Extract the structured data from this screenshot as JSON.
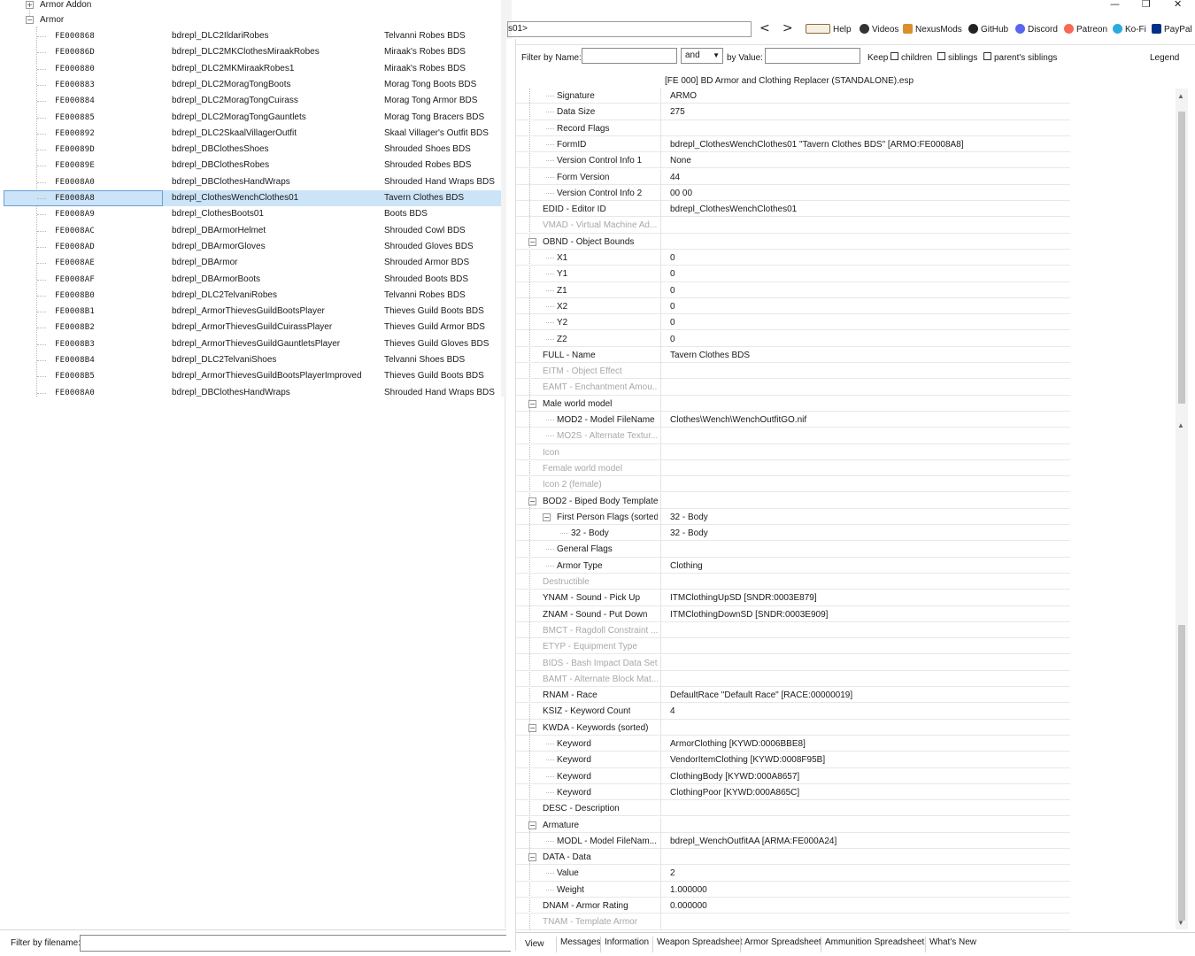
{
  "window": {
    "minimize": "—",
    "restore": "❐",
    "close": "✕"
  },
  "tree": {
    "nodes": [
      {
        "label": "Armor Addon",
        "expander": "+"
      },
      {
        "label": "Armor",
        "expander": "−"
      }
    ],
    "selected_index": 10,
    "records": [
      {
        "formid": "FE000868",
        "editor_id": "bdrepl_DLC2IldariRobes",
        "name": "Telvanni Robes BDS"
      },
      {
        "formid": "FE00086D",
        "editor_id": "bdrepl_DLC2MKClothesMiraakRobes",
        "name": "Miraak's Robes BDS"
      },
      {
        "formid": "FE000880",
        "editor_id": "bdrepl_DLC2MKMiraakRobes1",
        "name": "Miraak's Robes BDS"
      },
      {
        "formid": "FE000883",
        "editor_id": "bdrepl_DLC2MoragTongBoots",
        "name": "Morag Tong Boots BDS"
      },
      {
        "formid": "FE000884",
        "editor_id": "bdrepl_DLC2MoragTongCuirass",
        "name": "Morag Tong Armor BDS"
      },
      {
        "formid": "FE000885",
        "editor_id": "bdrepl_DLC2MoragTongGauntlets",
        "name": "Morag Tong Bracers BDS"
      },
      {
        "formid": "FE000892",
        "editor_id": "bdrepl_DLC2SkaalVillagerOutfit",
        "name": "Skaal Villager's Outfit BDS"
      },
      {
        "formid": "FE00089D",
        "editor_id": "bdrepl_DBClothesShoes",
        "name": "Shrouded Shoes BDS"
      },
      {
        "formid": "FE00089E",
        "editor_id": "bdrepl_DBClothesRobes",
        "name": "Shrouded Robes BDS"
      },
      {
        "formid": "FE0008A0",
        "editor_id": "bdrepl_DBClothesHandWraps",
        "name": "Shrouded Hand Wraps BDS"
      },
      {
        "formid": "FE0008A8",
        "editor_id": "bdrepl_ClothesWenchClothes01",
        "name": "Tavern Clothes BDS"
      },
      {
        "formid": "FE0008A9",
        "editor_id": "bdrepl_ClothesBoots01",
        "name": "Boots BDS"
      },
      {
        "formid": "FE0008AC",
        "editor_id": "bdrepl_DBArmorHelmet",
        "name": "Shrouded Cowl BDS"
      },
      {
        "formid": "FE0008AD",
        "editor_id": "bdrepl_DBArmorGloves",
        "name": "Shrouded Gloves BDS"
      },
      {
        "formid": "FE0008AE",
        "editor_id": "bdrepl_DBArmor",
        "name": "Shrouded Armor BDS"
      },
      {
        "formid": "FE0008AF",
        "editor_id": "bdrepl_DBArmorBoots",
        "name": "Shrouded Boots BDS"
      },
      {
        "formid": "FE0008B0",
        "editor_id": "bdrepl_DLC2TelvaniRobes",
        "name": "Telvanni Robes BDS"
      },
      {
        "formid": "FE0008B1",
        "editor_id": "bdrepl_ArmorThievesGuildBootsPlayer",
        "name": "Thieves Guild Boots BDS"
      },
      {
        "formid": "FE0008B2",
        "editor_id": "bdrepl_ArmorThievesGuildCuirassPlayer",
        "name": "Thieves Guild Armor BDS"
      },
      {
        "formid": "FE0008B3",
        "editor_id": "bdrepl_ArmorThievesGuildGauntletsPlayer",
        "name": "Thieves Guild Gloves BDS"
      },
      {
        "formid": "FE0008B4",
        "editor_id": "bdrepl_DLC2TelvaniShoes",
        "name": "Telvanni Shoes BDS"
      },
      {
        "formid": "FE0008B5",
        "editor_id": "bdrepl_ArmorThievesGuildBootsPlayerImproved",
        "name": "Thieves Guild Boots BDS"
      },
      {
        "formid": "FE0008A0",
        "editor_id": "bdrepl_DBClothesHandWraps",
        "name": "Shrouded Hand Wraps BDS"
      }
    ]
  },
  "left_filter": {
    "label": "Filter by filename:",
    "value": ""
  },
  "toolbar": {
    "path": "s01>",
    "back": "<",
    "forward": ">",
    "links": [
      {
        "label": "Help",
        "icon": "book-icon",
        "color": "#8a6a3a"
      },
      {
        "label": "Videos",
        "icon": "film-icon",
        "color": "#333333"
      },
      {
        "label": "NexusMods",
        "icon": "nexus-icon",
        "color": "#d98f2b"
      },
      {
        "label": "GitHub",
        "icon": "github-icon",
        "color": "#222222"
      },
      {
        "label": "Discord",
        "icon": "discord-icon",
        "color": "#5865f2"
      },
      {
        "label": "Patreon",
        "icon": "patreon-icon",
        "color": "#f96854"
      },
      {
        "label": "Ko-Fi",
        "icon": "kofi-icon",
        "color": "#29abe0"
      },
      {
        "label": "PayPal",
        "icon": "paypal-icon",
        "color": "#003087"
      }
    ]
  },
  "filter": {
    "by_name_label": "Filter by Name:",
    "name_value": "",
    "operator": "and",
    "by_value_label": "by Value:",
    "value_value": "",
    "keep_label": "Keep",
    "children_label": "children",
    "siblings_label": "siblings",
    "parents_siblings_label": "parent's siblings",
    "legend_label": "Legend"
  },
  "view": {
    "header": "[FE 000] BD Armor and Clothing Replacer (STANDALONE).esp",
    "rows": [
      {
        "key": "Signature",
        "value": "ARMO",
        "level": 1,
        "dim": false,
        "expander": ""
      },
      {
        "key": "Data Size",
        "value": "275",
        "level": 1,
        "dim": false,
        "expander": ""
      },
      {
        "key": "Record Flags",
        "value": "",
        "level": 1,
        "dim": false,
        "expander": ""
      },
      {
        "key": "FormID",
        "value": "bdrepl_ClothesWenchClothes01 \"Tavern Clothes BDS\" [ARMO:FE0008A8]",
        "level": 1,
        "dim": false,
        "expander": ""
      },
      {
        "key": "Version Control Info 1",
        "value": "None",
        "level": 1,
        "dim": false,
        "expander": ""
      },
      {
        "key": "Form Version",
        "value": "44",
        "level": 1,
        "dim": false,
        "expander": ""
      },
      {
        "key": "Version Control Info 2",
        "value": "00 00",
        "level": 1,
        "dim": false,
        "expander": ""
      },
      {
        "key": "EDID - Editor ID",
        "value": "bdrepl_ClothesWenchClothes01",
        "level": 0,
        "dim": false,
        "expander": ""
      },
      {
        "key": "VMAD - Virtual Machine Ad...",
        "value": "",
        "level": 0,
        "dim": true,
        "expander": ""
      },
      {
        "key": "OBND - Object Bounds",
        "value": "",
        "level": 0,
        "dim": false,
        "expander": "−"
      },
      {
        "key": "X1",
        "value": "0",
        "level": 1,
        "dim": false,
        "expander": ""
      },
      {
        "key": "Y1",
        "value": "0",
        "level": 1,
        "dim": false,
        "expander": ""
      },
      {
        "key": "Z1",
        "value": "0",
        "level": 1,
        "dim": false,
        "expander": ""
      },
      {
        "key": "X2",
        "value": "0",
        "level": 1,
        "dim": false,
        "expander": ""
      },
      {
        "key": "Y2",
        "value": "0",
        "level": 1,
        "dim": false,
        "expander": ""
      },
      {
        "key": "Z2",
        "value": "0",
        "level": 1,
        "dim": false,
        "expander": ""
      },
      {
        "key": "FULL - Name",
        "value": "Tavern Clothes BDS",
        "level": 0,
        "dim": false,
        "expander": ""
      },
      {
        "key": "EITM - Object Effect",
        "value": "",
        "level": 0,
        "dim": true,
        "expander": ""
      },
      {
        "key": "EAMT - Enchantment Amou...",
        "value": "",
        "level": 0,
        "dim": true,
        "expander": ""
      },
      {
        "key": "Male world model",
        "value": "",
        "level": 0,
        "dim": false,
        "expander": "−"
      },
      {
        "key": "MOD2 - Model FileName",
        "value": "Clothes\\Wench\\WenchOutfitGO.nif",
        "level": 1,
        "dim": false,
        "expander": ""
      },
      {
        "key": "MO2S - Alternate Textur...",
        "value": "",
        "level": 1,
        "dim": true,
        "expander": ""
      },
      {
        "key": "Icon",
        "value": "",
        "level": 0,
        "dim": true,
        "expander": ""
      },
      {
        "key": "Female world model",
        "value": "",
        "level": 0,
        "dim": true,
        "expander": ""
      },
      {
        "key": "Icon 2 (female)",
        "value": "",
        "level": 0,
        "dim": true,
        "expander": ""
      },
      {
        "key": "BOD2 - Biped Body Template",
        "value": "",
        "level": 0,
        "dim": false,
        "expander": "−"
      },
      {
        "key": "First Person Flags (sorted)",
        "value": "32 - Body",
        "level": 1,
        "dim": false,
        "expander": "−"
      },
      {
        "key": "32 - Body",
        "value": "32 - Body",
        "level": 2,
        "dim": false,
        "expander": ""
      },
      {
        "key": "General Flags",
        "value": "",
        "level": 1,
        "dim": false,
        "expander": ""
      },
      {
        "key": "Armor Type",
        "value": "Clothing",
        "level": 1,
        "dim": false,
        "expander": ""
      },
      {
        "key": "Destructible",
        "value": "",
        "level": 0,
        "dim": true,
        "expander": ""
      },
      {
        "key": "YNAM - Sound - Pick Up",
        "value": "ITMClothingUpSD [SNDR:0003E879]",
        "level": 0,
        "dim": false,
        "expander": ""
      },
      {
        "key": "ZNAM - Sound - Put Down",
        "value": "ITMClothingDownSD [SNDR:0003E909]",
        "level": 0,
        "dim": false,
        "expander": ""
      },
      {
        "key": "BMCT - Ragdoll Constraint ...",
        "value": "",
        "level": 0,
        "dim": true,
        "expander": ""
      },
      {
        "key": "ETYP - Equipment Type",
        "value": "",
        "level": 0,
        "dim": true,
        "expander": ""
      },
      {
        "key": "BIDS - Bash Impact Data Set",
        "value": "",
        "level": 0,
        "dim": true,
        "expander": ""
      },
      {
        "key": "BAMT - Alternate Block Mat...",
        "value": "",
        "level": 0,
        "dim": true,
        "expander": ""
      },
      {
        "key": "RNAM - Race",
        "value": "DefaultRace \"Default Race\" [RACE:00000019]",
        "level": 0,
        "dim": false,
        "expander": ""
      },
      {
        "key": "KSIZ - Keyword Count",
        "value": "4",
        "level": 0,
        "dim": false,
        "expander": ""
      },
      {
        "key": "KWDA - Keywords (sorted)",
        "value": "",
        "level": 0,
        "dim": false,
        "expander": "−"
      },
      {
        "key": "Keyword",
        "value": "ArmorClothing [KYWD:0006BBE8]",
        "level": 1,
        "dim": false,
        "expander": ""
      },
      {
        "key": "Keyword",
        "value": "VendorItemClothing [KYWD:0008F95B]",
        "level": 1,
        "dim": false,
        "expander": ""
      },
      {
        "key": "Keyword",
        "value": "ClothingBody [KYWD:000A8657]",
        "level": 1,
        "dim": false,
        "expander": ""
      },
      {
        "key": "Keyword",
        "value": "ClothingPoor [KYWD:000A865C]",
        "level": 1,
        "dim": false,
        "expander": ""
      },
      {
        "key": "DESC - Description",
        "value": "",
        "level": 0,
        "dim": false,
        "expander": ""
      },
      {
        "key": "Armature",
        "value": "",
        "level": 0,
        "dim": false,
        "expander": "−"
      },
      {
        "key": "MODL - Model FileNam...",
        "value": "bdrepl_WenchOutfitAA [ARMA:FE000A24]",
        "level": 1,
        "dim": false,
        "expander": ""
      },
      {
        "key": "DATA - Data",
        "value": "",
        "level": 0,
        "dim": false,
        "expander": "−"
      },
      {
        "key": "Value",
        "value": "2",
        "level": 1,
        "dim": false,
        "expander": ""
      },
      {
        "key": "Weight",
        "value": "1.000000",
        "level": 1,
        "dim": false,
        "expander": ""
      },
      {
        "key": "DNAM - Armor Rating",
        "value": "0.000000",
        "level": 0,
        "dim": false,
        "expander": ""
      },
      {
        "key": "TNAM - Template Armor",
        "value": "",
        "level": 0,
        "dim": true,
        "expander": ""
      }
    ]
  },
  "tabs": [
    {
      "label": "View",
      "active": true
    },
    {
      "label": "Messages",
      "active": false
    },
    {
      "label": "Information",
      "active": false
    },
    {
      "label": "Weapon Spreadsheet",
      "active": false
    },
    {
      "label": "Armor Spreadsheet",
      "active": false
    },
    {
      "label": "Ammunition Spreadsheet",
      "active": false
    },
    {
      "label": "What's New",
      "active": false
    }
  ]
}
